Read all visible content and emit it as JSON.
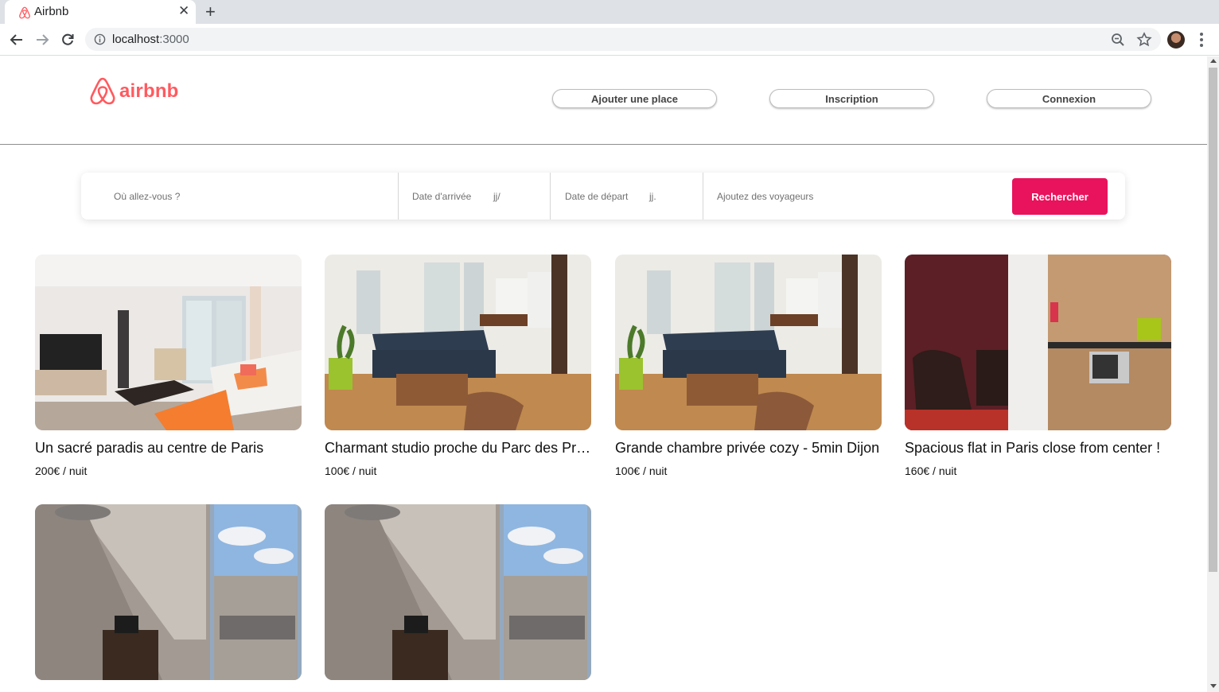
{
  "browser": {
    "tab_title": "Airbnb",
    "url_host": "localhost",
    "url_port": ":3000"
  },
  "header": {
    "logo_text": "airbnb",
    "buttons": [
      "Ajouter une place",
      "Inscription",
      "Connexion"
    ]
  },
  "search": {
    "location_placeholder": "Où allez-vous ?",
    "checkin_label": "Date d'arrivée",
    "checkin_mask": "jj/",
    "checkout_label": "Date de départ",
    "checkout_mask": "jj.",
    "guests_placeholder": "Ajoutez des voyageurs",
    "button_label": "Rechercher"
  },
  "listings": [
    {
      "title": "Un sacré paradis au centre de Paris",
      "price": "200€ / nuit",
      "image": "living-room-white-sofa"
    },
    {
      "title": "Charmant studio proche du Parc des Princes",
      "price": "100€ / nuit",
      "image": "living-room-blue-sofa"
    },
    {
      "title": "Grande chambre privée cozy - 5min Dijon",
      "price": "100€ / nuit",
      "image": "living-room-blue-sofa"
    },
    {
      "title": "Spacious flat in Paris close from center !",
      "price": "160€ / nuit",
      "image": "studio-kitchen-leather-chair"
    },
    {
      "title": "",
      "price": "",
      "image": "attic-room-window-view"
    },
    {
      "title": "",
      "price": "",
      "image": "attic-room-window-view"
    }
  ],
  "colors": {
    "brand": "#ff5a5f",
    "search_button": "#e8135c"
  }
}
